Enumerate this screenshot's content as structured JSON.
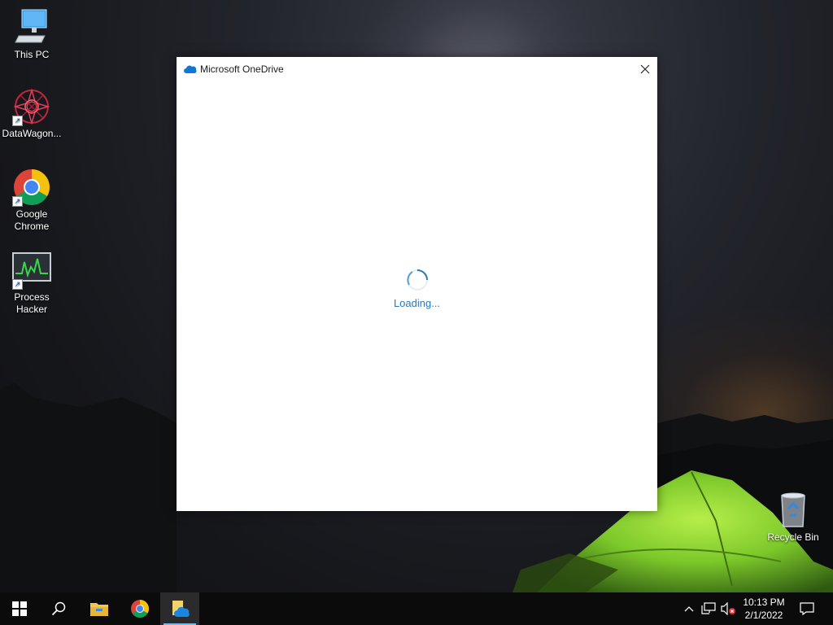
{
  "desktop": {
    "icons": [
      {
        "label": "This PC"
      },
      {
        "label": "DataWagon..."
      },
      {
        "label": "Google Chrome"
      },
      {
        "label": "Process Hacker"
      },
      {
        "label": "Recycle Bin"
      }
    ]
  },
  "window": {
    "title": "Microsoft OneDrive",
    "loading_text": "Loading..."
  },
  "taskbar": {
    "time": "10:13 PM",
    "date": "2/1/2022"
  },
  "colors": {
    "accent": "#76b9ed",
    "loading": "#2a7ab8",
    "onedrive": "#0f78d4"
  }
}
